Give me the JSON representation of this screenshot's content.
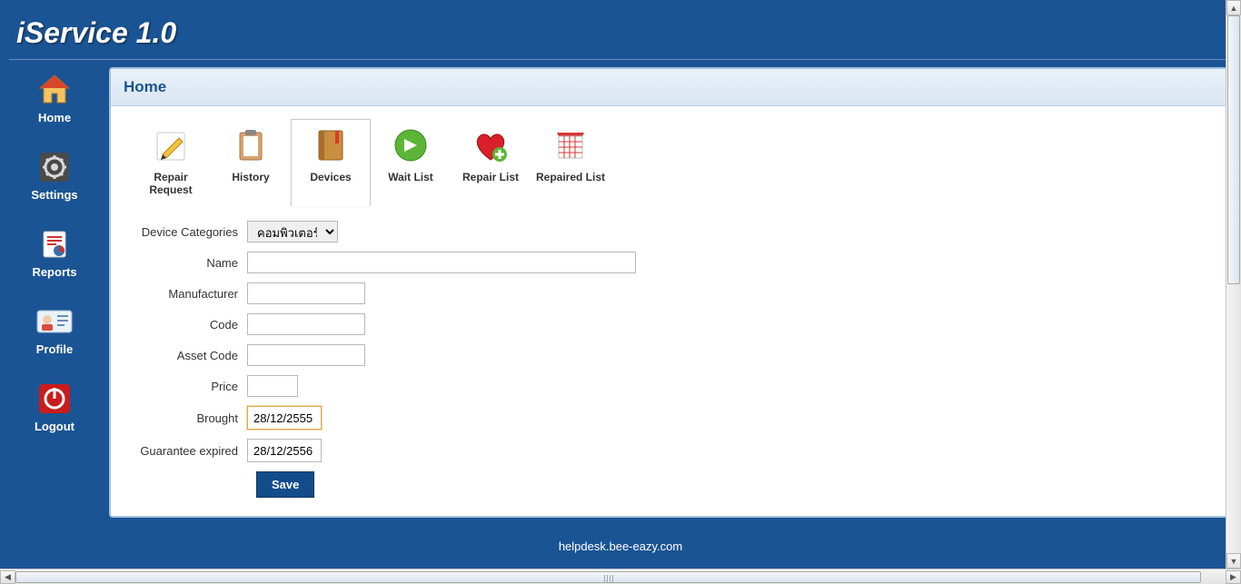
{
  "app": {
    "title": "iService 1.0"
  },
  "sidebar": {
    "items": [
      {
        "label": "Home"
      },
      {
        "label": "Settings"
      },
      {
        "label": "Reports"
      },
      {
        "label": "Profile"
      },
      {
        "label": "Logout"
      }
    ]
  },
  "panel": {
    "title": "Home"
  },
  "toolbar": {
    "items": [
      {
        "label": "Repair Request"
      },
      {
        "label": "History"
      },
      {
        "label": "Devices"
      },
      {
        "label": "Wait List"
      },
      {
        "label": "Repair List"
      },
      {
        "label": "Repaired List"
      }
    ]
  },
  "form": {
    "labels": {
      "category": "Device Categories",
      "name": "Name",
      "manufacturer": "Manufacturer",
      "code": "Code",
      "asset_code": "Asset Code",
      "price": "Price",
      "brought": "Brought",
      "guarantee": "Guarantee expired"
    },
    "values": {
      "category_selected": "คอมพิวเตอร์",
      "name": "",
      "manufacturer": "",
      "code": "",
      "asset_code": "",
      "price": "",
      "brought": "28/12/2555",
      "guarantee": "28/12/2556"
    },
    "save_label": "Save"
  },
  "footer": {
    "text": "helpdesk.bee-eazy.com"
  }
}
